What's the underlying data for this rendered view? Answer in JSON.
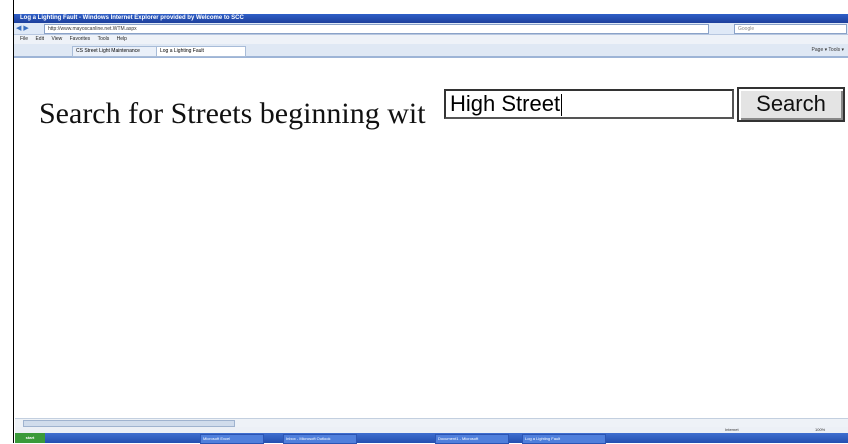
{
  "window": {
    "title": "Log a Lighting Fault - Windows Internet Explorer provided by Welcome to SCC"
  },
  "addressbar": {
    "url": "http://www.mayoscanline.net.WTM.aspx",
    "search_placeholder": "Google"
  },
  "menubar": [
    "File",
    "Edit",
    "View",
    "Favorites",
    "Tools",
    "Help"
  ],
  "tabs": [
    "CS Street Light Maintenance",
    "Log a Lighting Fault"
  ],
  "toolbar_right": "Page ▾  Tools ▾",
  "page": {
    "prompt": "Search for Streets beginning wit",
    "search_value": "High Street",
    "search_button": "Search"
  },
  "statusbar": {
    "zone": "Internet",
    "zoom": "100%"
  },
  "taskbar": {
    "start": "start",
    "items": [
      "Microsoft Excel",
      "Inbox - Microsoft Outlook",
      "Document1 - Microsoft",
      "Log a Lighting Fault"
    ]
  }
}
